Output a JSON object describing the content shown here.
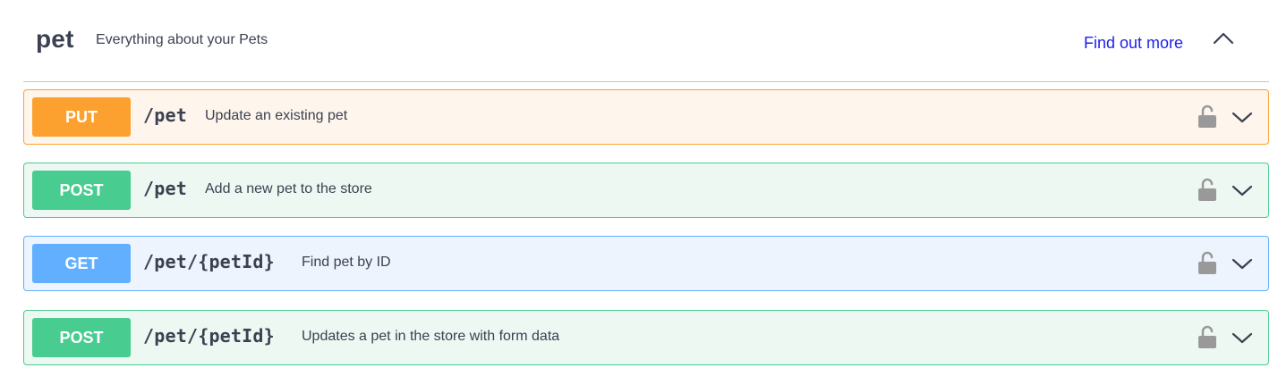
{
  "tag": {
    "name": "pet",
    "description": "Everything about your Pets",
    "link_label": "Find out more",
    "toggle_icon": "chevron-up-icon"
  },
  "operations": [
    {
      "method": "PUT",
      "path": "/pet",
      "summary": "Update an existing pet",
      "color": "#fca130"
    },
    {
      "method": "POST",
      "path": "/pet",
      "summary": "Add a new pet to the store",
      "color": "#49cc90"
    },
    {
      "method": "GET",
      "path": "/pet/{petId}",
      "summary": "Find pet by ID",
      "color": "#61affe"
    },
    {
      "method": "POST",
      "path": "/pet/{petId}",
      "summary": "Updates a pet in the store with form data",
      "color": "#49cc90"
    }
  ],
  "icons": {
    "lock": "lock-open-icon",
    "expand": "chevron-down-icon"
  }
}
